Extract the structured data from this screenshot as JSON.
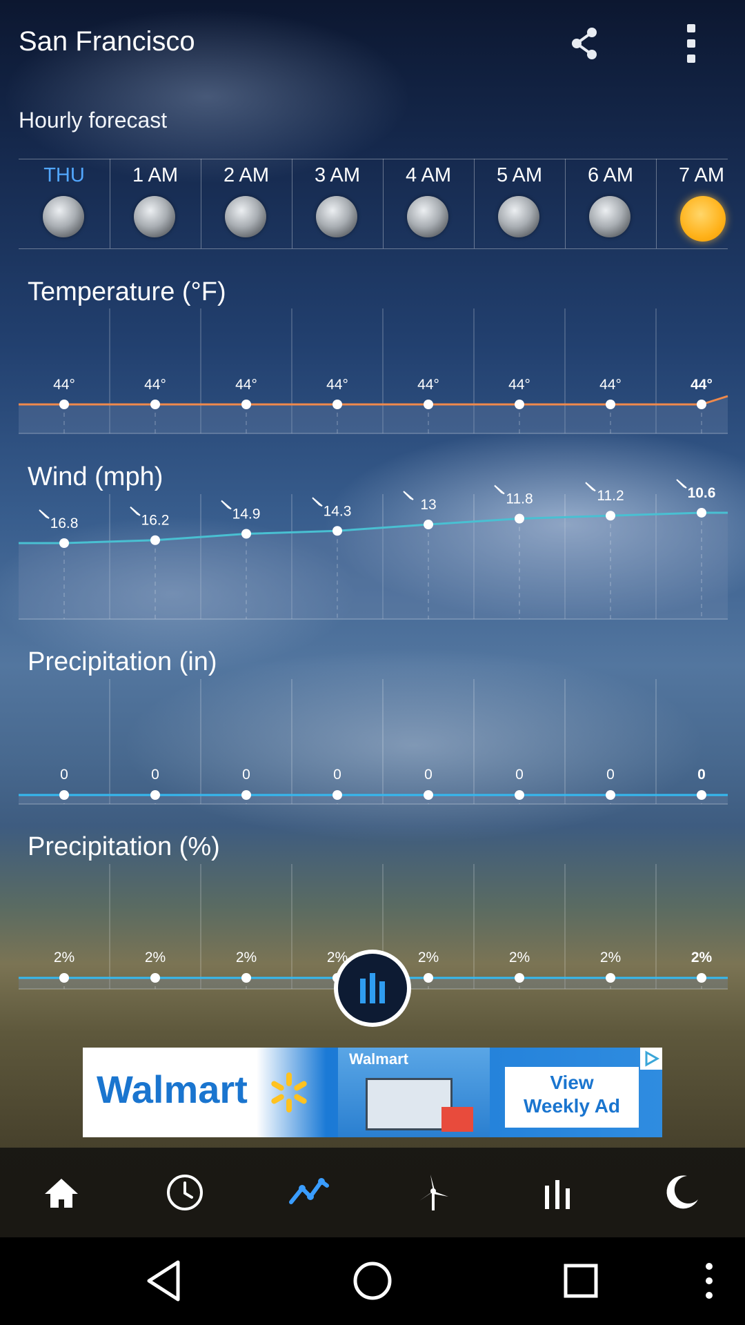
{
  "header": {
    "city": "San Francisco",
    "share_icon": "share-icon",
    "menu_icon": "more-vert-icon"
  },
  "forecast": {
    "heading": "Hourly forecast",
    "hours": [
      {
        "label": "THU",
        "icon": "moon-icon",
        "active": true
      },
      {
        "label": "1 AM",
        "icon": "moon-icon"
      },
      {
        "label": "2 AM",
        "icon": "moon-icon"
      },
      {
        "label": "3 AM",
        "icon": "moon-icon"
      },
      {
        "label": "4 AM",
        "icon": "moon-icon"
      },
      {
        "label": "5 AM",
        "icon": "moon-icon"
      },
      {
        "label": "6 AM",
        "icon": "moon-icon"
      },
      {
        "label": "7 AM",
        "icon": "sun-icon"
      }
    ]
  },
  "sections": {
    "temperature": {
      "title": "Temperature (°F)",
      "labels": [
        "44°",
        "44°",
        "44°",
        "44°",
        "44°",
        "44°",
        "44°",
        "44°"
      ],
      "values": [
        44,
        44,
        44,
        44,
        44,
        44,
        44,
        44
      ],
      "line_color": "#f08a4b"
    },
    "wind": {
      "title": "Wind (mph)",
      "labels": [
        "16.8",
        "16.2",
        "14.9",
        "14.3",
        "13",
        "11.8",
        "11.2",
        "10.6"
      ],
      "values": [
        16.8,
        16.2,
        14.9,
        14.3,
        13,
        11.8,
        11.2,
        10.6
      ],
      "line_color": "#49c0d2"
    },
    "precip_in": {
      "title": "Precipitation (in)",
      "labels": [
        "0",
        "0",
        "0",
        "0",
        "0",
        "0",
        "0",
        "0"
      ],
      "values": [
        0,
        0,
        0,
        0,
        0,
        0,
        0,
        0
      ],
      "line_color": "#35b9f0"
    },
    "precip_pct": {
      "title": "Precipitation (%)",
      "labels": [
        "2%",
        "2%",
        "2%",
        "2%",
        "2%",
        "2%",
        "2%",
        "2%"
      ],
      "values": [
        2,
        2,
        2,
        2,
        2,
        2,
        2,
        2
      ],
      "line_color": "#35b9f0"
    }
  },
  "ad": {
    "brand": "Walmart",
    "cta_line1": "View",
    "cta_line2": "Weekly Ad",
    "badge": "Walmart"
  },
  "bottom_nav": [
    {
      "name": "home-icon",
      "active": false
    },
    {
      "name": "clock-icon",
      "active": false
    },
    {
      "name": "chart-line-icon",
      "active": true
    },
    {
      "name": "wind-turbine-icon",
      "active": false
    },
    {
      "name": "bar-chart-icon",
      "active": false
    },
    {
      "name": "moon-icon",
      "active": false
    }
  ],
  "colors": {
    "active_hour": "#52a7ff",
    "active_nav": "#3a9dff"
  }
}
